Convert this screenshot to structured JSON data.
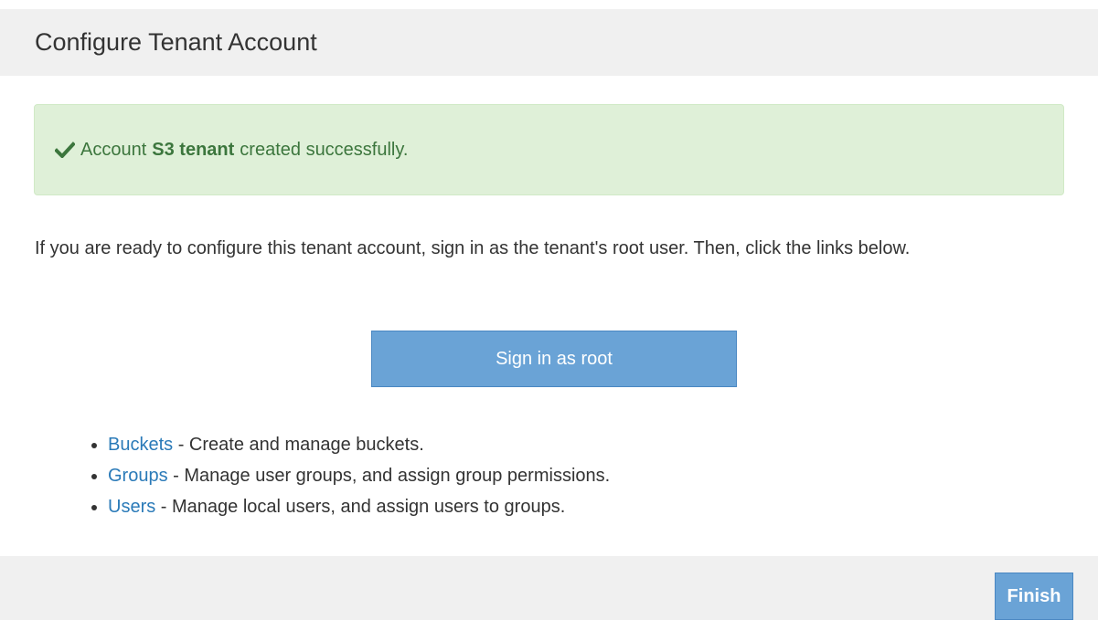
{
  "header": {
    "title": "Configure Tenant Account"
  },
  "alert": {
    "icon": "checkmark-icon",
    "prefix": "Account",
    "account_name": "S3 tenant",
    "suffix": "created successfully.",
    "color": "#3c763d",
    "background": "#dff0d8"
  },
  "instructions": {
    "text": "If you are ready to configure this tenant account, sign in as the tenant's root user. Then, click the links below."
  },
  "signin_button": {
    "label": "Sign in as root"
  },
  "links": [
    {
      "link_label": "Buckets",
      "description": " - Create and manage buckets."
    },
    {
      "link_label": "Groups",
      "description": " - Manage user groups, and assign group permissions."
    },
    {
      "link_label": "Users",
      "description": " - Manage local users, and assign users to groups."
    }
  ],
  "footer": {
    "finish_label": "Finish"
  },
  "colors": {
    "accent": "#6aa3d6",
    "link": "#2a7ab8",
    "panel": "#f0f0f0"
  }
}
